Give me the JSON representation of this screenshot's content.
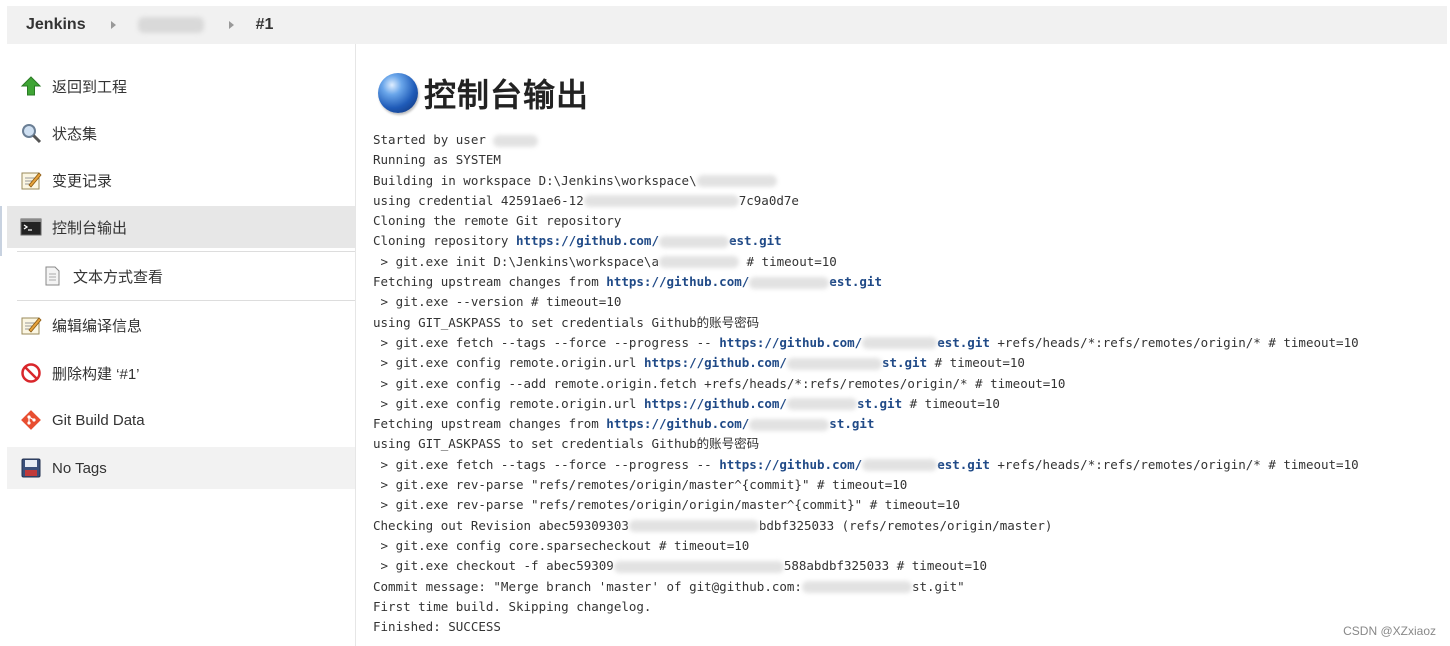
{
  "breadcrumb": {
    "root": "Jenkins",
    "build": "#1"
  },
  "sidebar": {
    "items": [
      {
        "label": "返回到工程",
        "icon": "up-arrow-icon"
      },
      {
        "label": "状态集",
        "icon": "search-icon"
      },
      {
        "label": "变更记录",
        "icon": "notepad-icon"
      },
      {
        "label": "控制台输出",
        "icon": "terminal-icon"
      },
      {
        "label": "文本方式查看",
        "icon": "document-icon"
      },
      {
        "label": "编辑编译信息",
        "icon": "notepad-icon"
      },
      {
        "label": "删除构建 ‘#1’",
        "icon": "no-entry-icon"
      },
      {
        "label": "Git Build Data",
        "icon": "git-icon"
      },
      {
        "label": "No Tags",
        "icon": "floppy-icon"
      }
    ]
  },
  "main": {
    "title": "控制台输出",
    "console": [
      {
        "t": "Started by user "
      },
      {
        "t": "Running as SYSTEM"
      },
      {
        "t": "Building in workspace D:\\Jenkins\\workspace\\"
      },
      {
        "t": "using credential 42591ae6-12",
        "tail": "7c9a0d7e"
      },
      {
        "t": "Cloning the remote Git repository"
      },
      {
        "t": "Cloning repository ",
        "link": "https://github.com/",
        "link2": "est.git"
      },
      {
        "t": " > git.exe init D:\\Jenkins\\workspace\\a",
        "tail": " # timeout=10"
      },
      {
        "t": "Fetching upstream changes from ",
        "link": "https://github.com/",
        "link2": "est.git"
      },
      {
        "t": " > git.exe --version # timeout=10"
      },
      {
        "t": "using GIT_ASKPASS to set credentials Github的账号密码"
      },
      {
        "t": " > git.exe fetch --tags --force --progress -- ",
        "link": "https://github.com/",
        "link2": "est.git",
        "tail": " +refs/heads/*:refs/remotes/origin/* # timeout=10"
      },
      {
        "t": " > git.exe config remote.origin.url ",
        "link": "https://github.com/",
        "link2": "st.git",
        "tail": " # timeout=10"
      },
      {
        "t": " > git.exe config --add remote.origin.fetch +refs/heads/*:refs/remotes/origin/* # timeout=10"
      },
      {
        "t": " > git.exe config remote.origin.url ",
        "link": "https://github.com/",
        "link2": "st.git",
        "tail": " # timeout=10"
      },
      {
        "t": "Fetching upstream changes from ",
        "link": "https://github.com/",
        "link2": "st.git"
      },
      {
        "t": "using GIT_ASKPASS to set credentials Github的账号密码"
      },
      {
        "t": " > git.exe fetch --tags --force --progress -- ",
        "link": "https://github.com/",
        "link2": "est.git",
        "tail": " +refs/heads/*:refs/remotes/origin/* # timeout=10"
      },
      {
        "t": " > git.exe rev-parse \"refs/remotes/origin/master^{commit}\" # timeout=10"
      },
      {
        "t": " > git.exe rev-parse \"refs/remotes/origin/origin/master^{commit}\" # timeout=10"
      },
      {
        "t": "Checking out Revision abec59309303",
        "tail": "bdbf325033 (refs/remotes/origin/master)"
      },
      {
        "t": " > git.exe config core.sparsecheckout # timeout=10"
      },
      {
        "t": " > git.exe checkout -f abec59309",
        "tail": "588abdbf325033 # timeout=10"
      },
      {
        "t": "Commit message: \"Merge branch 'master' of git@github.com:",
        "tail": "st.git\""
      },
      {
        "t": "First time build. Skipping changelog."
      },
      {
        "t": "Finished: SUCCESS"
      }
    ]
  },
  "watermark": "CSDN @XZxiaoz",
  "colors": {
    "link": "#204a87",
    "active_bg": "#e7e7e7",
    "topbar_bg": "#f1f1f1"
  }
}
